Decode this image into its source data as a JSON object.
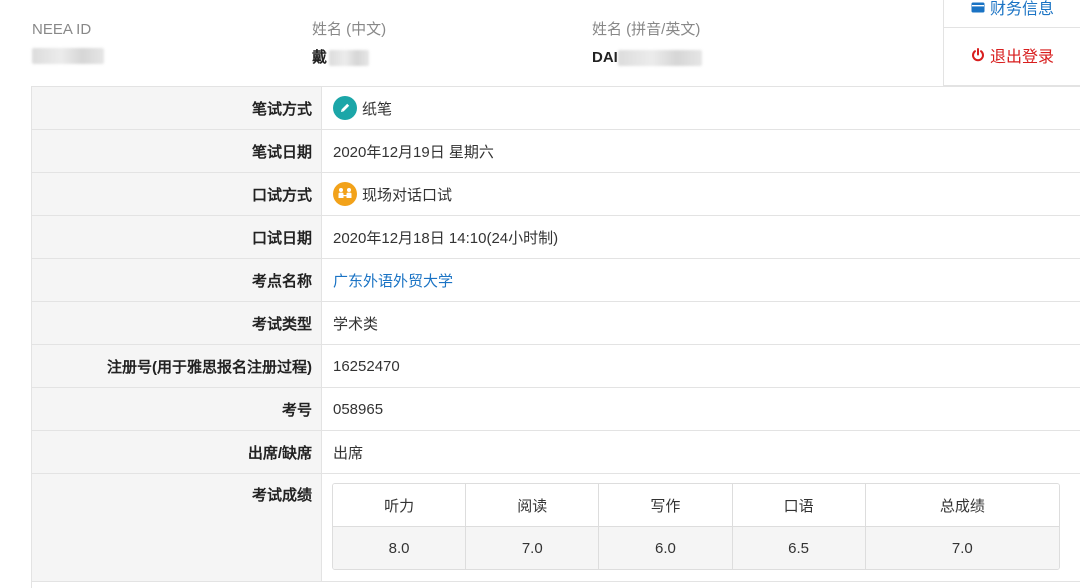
{
  "header": {
    "neea_id_label": "NEEA ID",
    "name_cn_label": "姓名 (中文)",
    "name_cn_value": "戴",
    "name_en_label": "姓名 (拼音/英文)",
    "name_en_value": "DAI"
  },
  "menu": {
    "finance_label": "财务信息",
    "logout_label": "退出登录"
  },
  "details": {
    "written_mode": {
      "label": "笔试方式",
      "value": "纸笔"
    },
    "written_date": {
      "label": "笔试日期",
      "value": "2020年12月19日 星期六"
    },
    "speaking_mode": {
      "label": "口试方式",
      "value": "现场对话口试"
    },
    "speaking_date": {
      "label": "口试日期",
      "value": "2020年12月18日 14:10(24小时制)"
    },
    "venue": {
      "label": "考点名称",
      "value": "广东外语外贸大学"
    },
    "exam_type": {
      "label": "考试类型",
      "value": "学术类"
    },
    "registration_no": {
      "label": "注册号(用于雅思报名注册过程)",
      "value": "16252470"
    },
    "candidate_no": {
      "label": "考号",
      "value": "058965"
    },
    "attendance": {
      "label": "出席/缺席",
      "value": "出席"
    },
    "scores_label": "考试成绩"
  },
  "scores": {
    "headers": [
      "听力",
      "阅读",
      "写作",
      "口语",
      "总成绩"
    ],
    "values": [
      "8.0",
      "7.0",
      "6.0",
      "6.5",
      "7.0"
    ]
  },
  "colors": {
    "link": "#1a73c4",
    "logout": "#d81e1e",
    "paper_badge": "#1ba6a8",
    "speaking_badge": "#f2a21a"
  },
  "icons": {
    "written_mode": "pencil-icon",
    "speaking_mode": "face-to-face-icon",
    "finance": "wallet-icon",
    "logout": "power-icon"
  }
}
